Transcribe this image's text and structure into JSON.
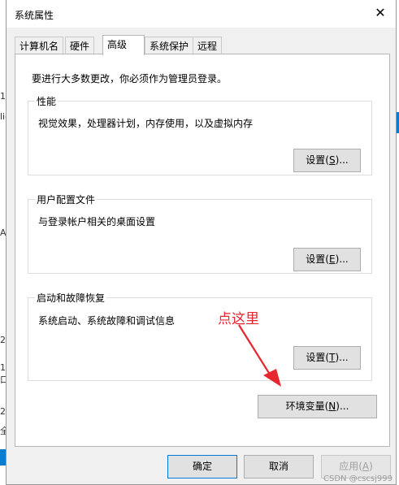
{
  "window": {
    "title": "系统属性"
  },
  "tabs": [
    {
      "label": "计算机名"
    },
    {
      "label": "硬件"
    },
    {
      "label": "高级"
    },
    {
      "label": "系统保护"
    },
    {
      "label": "远程"
    }
  ],
  "intro": "要进行大多数更改，你必须作为管理员登录。",
  "performance": {
    "title": "性能",
    "desc": "视觉效果，处理器计划，内存使用，以及虚拟内存",
    "btn_text": "设置(",
    "btn_key": "S",
    "btn_tail": ")..."
  },
  "profile": {
    "title": "用户配置文件",
    "desc": "与登录帐户相关的桌面设置",
    "btn_text": "设置(",
    "btn_key": "E",
    "btn_tail": ")..."
  },
  "startup": {
    "title": "启动和故障恢复",
    "desc": "系统启动、系统故障和调试信息",
    "btn_text": "设置(",
    "btn_key": "T",
    "btn_tail": ")..."
  },
  "env": {
    "btn_text": "环境变量(",
    "btn_key": "N",
    "btn_tail": ")..."
  },
  "footer": {
    "ok": "确定",
    "cancel": "取消",
    "apply_text": "应用(",
    "apply_key": "A",
    "apply_tail": ")"
  },
  "annotation": {
    "text": "点这里",
    "color": "#e8262e"
  },
  "watermark": "CSDN @cscsj999",
  "background": {
    "left_glyphs": [
      "1(",
      "lic",
      "A",
      "2:",
      "1口",
      "2:",
      "全"
    ]
  }
}
